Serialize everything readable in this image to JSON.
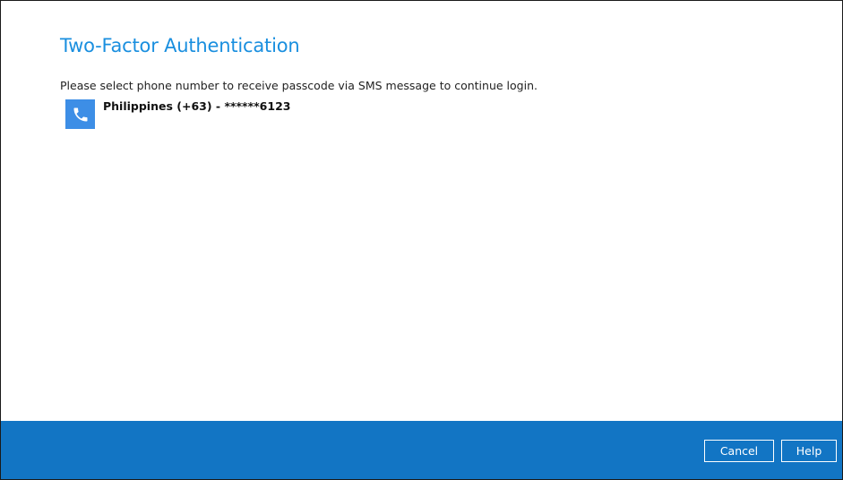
{
  "dialog": {
    "title": "Two-Factor Authentication",
    "instruction": "Please select phone number to receive passcode via SMS message to continue login."
  },
  "phone_options": [
    {
      "icon": "phone-icon",
      "label": "Philippines (+63) - ******6123"
    }
  ],
  "footer": {
    "cancel_label": "Cancel",
    "help_label": "Help"
  },
  "colors": {
    "title": "#1a8fdf",
    "footer_background": "#1275c4",
    "icon_background": "#3d8ee6"
  }
}
